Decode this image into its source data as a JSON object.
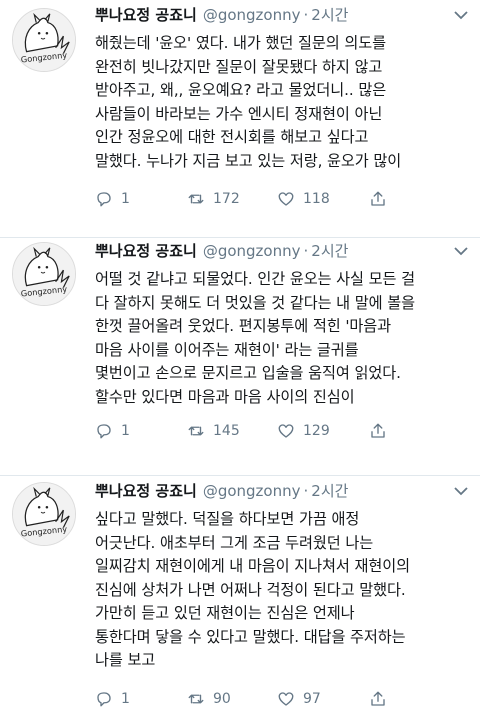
{
  "tweets": [
    {
      "author_name": "뿌나요정 공죠니",
      "handle": "@gongzonny",
      "separator": "·",
      "time": "2시간",
      "text": "해줬는데 '윤오' 였다. 내가 했던 질문의 의도를\n완전히 빗나갔지만 질문이 잘못됐다 하지 않고\n받아주고, 왜,, 윤오예요? 라고 물었더니.. 많은\n사람들이 바라보는 가수 엔시티 정재현이 아닌\n인간 정윤오에 대한 전시회를 해보고 싶다고\n말했다. 누나가 지금 보고 있는 저랑, 윤오가 많이",
      "replies": "1",
      "retweets": "172",
      "likes": "118"
    },
    {
      "author_name": "뿌나요정 공죠니",
      "handle": "@gongzonny",
      "separator": "·",
      "time": "2시간",
      "text": "어떨 것 같냐고 되물었다. 인간 윤오는 사실 모든 걸\n다 잘하지 못해도 더 멋있을 것 같다는 내 말에 볼을\n한껏 끌어올려 웃었다. 편지봉투에 적힌 '마음과\n마음 사이를 이어주는 재현이' 라는 글귀를\n몇번이고 손으로 문지르고 입술을 움직여 읽었다.\n할수만 있다면 마음과 마음 사이의 진심이",
      "replies": "1",
      "retweets": "145",
      "likes": "129"
    },
    {
      "author_name": "뿌나요정 공죠니",
      "handle": "@gongzonny",
      "separator": "·",
      "time": "2시간",
      "text": "싶다고 말했다. 덕질을 하다보면 가끔 애정\n어긋난다. 애초부터 그게 조금 두려웠던 나는\n일찌감치 재현이에게 내 마음이 지나쳐서 재현이의\n진심에 상처가 나면 어쩌나 걱정이 된다고 말했다.\n가만히 듣고 있던 재현이는 진심은 언제나\n통한다며 닿을 수 있다고 말했다. 대답을 주저하는\n나를 보고",
      "replies": "1",
      "retweets": "90",
      "likes": "97"
    }
  ],
  "avatar_caption": "Gongzonny",
  "icons": {
    "reply": "reply-icon",
    "retweet": "retweet-icon",
    "like": "heart-icon",
    "share": "share-icon",
    "menu": "chevron-down-icon"
  },
  "colors": {
    "text": "#14171a",
    "secondary": "#657786",
    "divider": "#e1e8ed"
  }
}
